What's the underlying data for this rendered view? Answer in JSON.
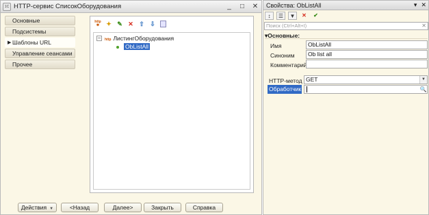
{
  "left_window": {
    "title": "HTTP-сервис СписокОборудования",
    "nav_items": [
      {
        "label": "Основные"
      },
      {
        "label": "Подсистемы"
      },
      {
        "label": "Шаблоны URL",
        "active": true
      },
      {
        "label": "Управление сеансами"
      },
      {
        "label": "Прочее"
      }
    ],
    "toolbar_icons": [
      "http-icon",
      "add-icon",
      "edit-icon",
      "delete-icon",
      "move-up-icon",
      "move-down-icon",
      "document-icon"
    ],
    "tree": {
      "root_icon_text": "http",
      "root_label": "ЛистингОборудования",
      "child_label": "ObListAll"
    },
    "buttons": {
      "actions": "Действия",
      "back": "<Назад",
      "next": "Далее>",
      "close": "Закрыть",
      "help": "Справка"
    }
  },
  "right_window": {
    "title": "Свойства: ObListAll",
    "search_placeholder": "Поиск (Ctrl+Alt+I)",
    "group_title": "Основные:",
    "props": {
      "name_label": "Имя",
      "name_value": "ObListAll",
      "synonym_label": "Синоним",
      "synonym_value": "Ob list all",
      "comment_label": "Комментарий",
      "comment_value": "",
      "http_method_label": "HTTP-метод",
      "http_method_value": "GET",
      "handler_label": "Обработчик",
      "handler_value": ""
    }
  },
  "colors": {
    "selection": "#316ac5",
    "panel_bg": "#fbf7e6"
  }
}
